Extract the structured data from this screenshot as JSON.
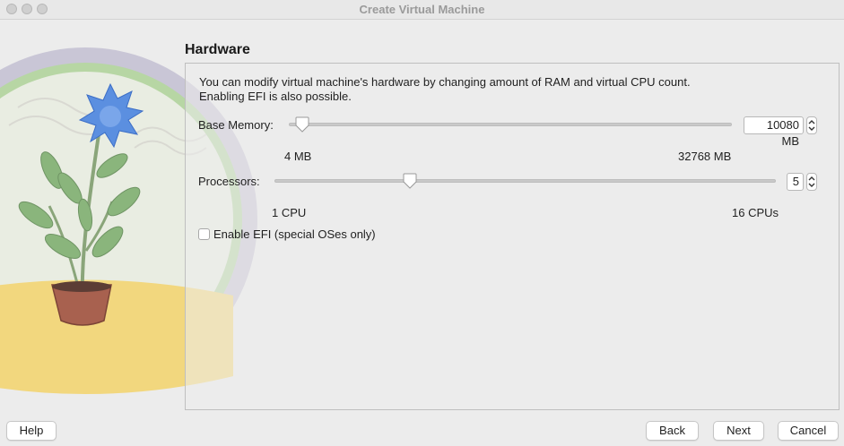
{
  "window": {
    "title": "Create Virtual Machine"
  },
  "section": {
    "title": "Hardware"
  },
  "description": {
    "line1": "You can modify virtual machine's hardware by changing amount of RAM and virtual CPU count.",
    "line2": "Enabling EFI is also possible."
  },
  "memory": {
    "label": "Base Memory:",
    "value": "10080 MB",
    "min_label": "4 MB",
    "max_label": "32768 MB",
    "level": 0.03
  },
  "processors": {
    "label": "Processors:",
    "value": "5",
    "min_label": "1 CPU",
    "max_label": "16 CPUs",
    "level": 0.27
  },
  "efi": {
    "label": "Enable EFI (special OSes only)",
    "checked": false
  },
  "buttons": {
    "help": "Help",
    "back": "Back",
    "next": "Next",
    "cancel": "Cancel"
  },
  "icons": [
    "close-icon",
    "minimize-icon",
    "zoom-icon",
    "chevron-up-icon",
    "chevron-down-icon",
    "plant-illustration"
  ]
}
